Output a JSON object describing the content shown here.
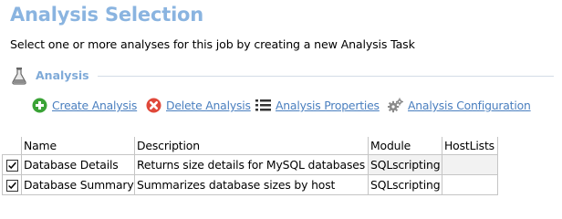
{
  "header": {
    "title": "Analysis Selection",
    "subtitle": "Select one or more analyses for this job by creating a new Analysis Task"
  },
  "section": {
    "label": "Analysis",
    "icon": "flask-icon"
  },
  "toolbar": {
    "create": {
      "label": "Create Analysis",
      "icon": "plus-circle-icon",
      "color": "#3aa336"
    },
    "delete": {
      "label": "Delete Analysis",
      "icon": "x-circle-icon",
      "color": "#e0483a"
    },
    "properties": {
      "label": "Analysis Properties",
      "icon": "list-icon"
    },
    "configuration": {
      "label": "Analysis Configuration",
      "icon": "gears-icon"
    }
  },
  "table": {
    "columns": [
      "Name",
      "Description",
      "Module",
      "HostLists"
    ],
    "rows": [
      {
        "checked": true,
        "name": "Database Details",
        "description": "Returns size details for MySQL databases",
        "module": "SQLscripting",
        "hostlists": ""
      },
      {
        "checked": true,
        "name": "Database Summary",
        "description": "Summarizes database sizes by host",
        "module": "SQLscripting",
        "hostlists": ""
      }
    ]
  },
  "colors": {
    "title": "#8ab4e0",
    "link": "#4a7fbf",
    "section_label": "#7faad8"
  }
}
